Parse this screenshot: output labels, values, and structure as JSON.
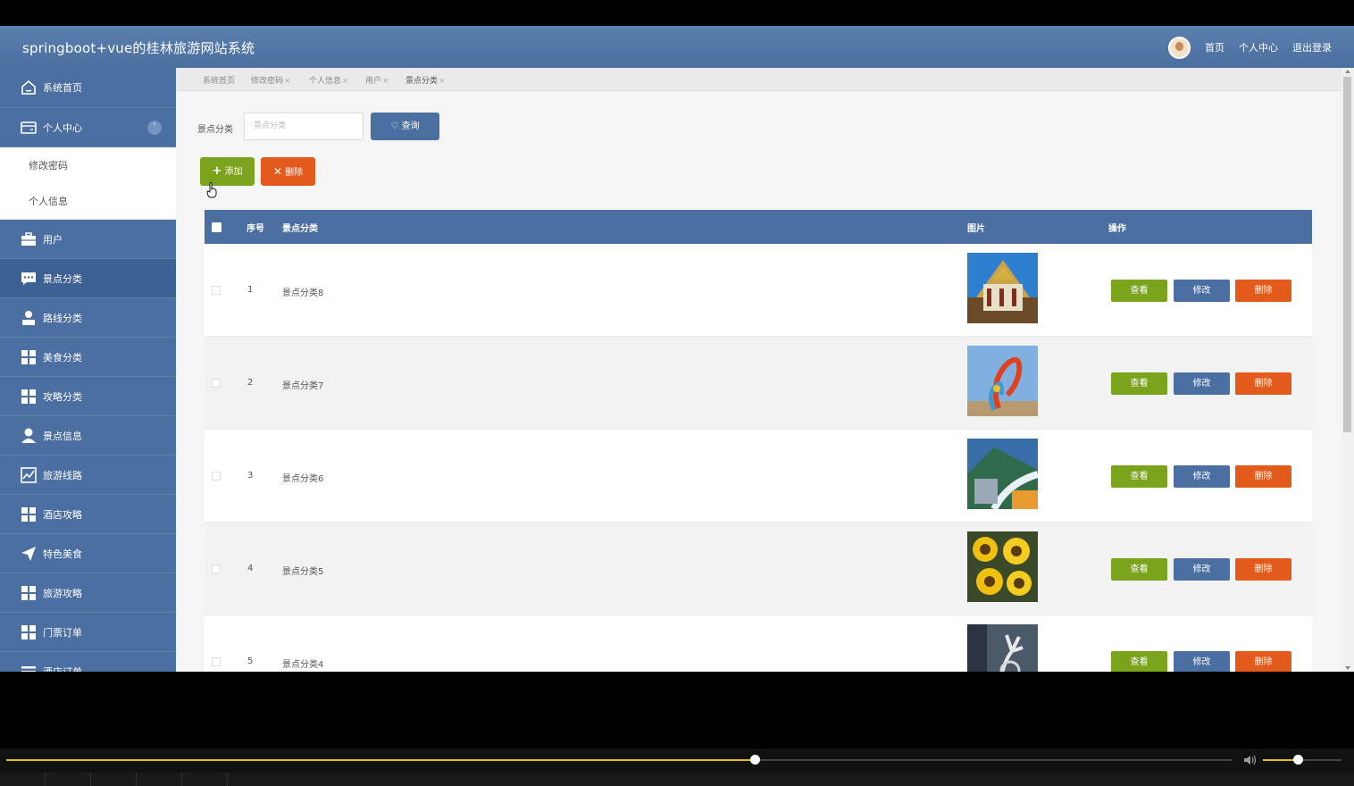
{
  "header": {
    "title": "springboot+vue的桂林旅游网站系统",
    "nav": {
      "home": "首页",
      "personal": "个人中心",
      "logout": "退出登录"
    }
  },
  "sidebar": {
    "items": [
      {
        "label": "系统首页",
        "icon": "home-icon"
      },
      {
        "label": "个人中心",
        "icon": "card-icon",
        "expanded": true,
        "children": [
          "修改密码",
          "个人信息"
        ]
      },
      {
        "label": "用户",
        "icon": "briefcase-icon"
      },
      {
        "label": "景点分类",
        "icon": "chat-icon",
        "active": true
      },
      {
        "label": "路线分类",
        "icon": "user-badge-icon"
      },
      {
        "label": "美食分类",
        "icon": "grid-icon"
      },
      {
        "label": "攻略分类",
        "icon": "grid-icon"
      },
      {
        "label": "景点信息",
        "icon": "user-icon"
      },
      {
        "label": "旅游线路",
        "icon": "chart-icon"
      },
      {
        "label": "酒店攻略",
        "icon": "grid-icon"
      },
      {
        "label": "特色美食",
        "icon": "send-icon"
      },
      {
        "label": "旅游攻略",
        "icon": "grid-icon"
      },
      {
        "label": "门票订单",
        "icon": "grid-icon"
      },
      {
        "label": "酒店订单",
        "icon": "list-icon"
      }
    ]
  },
  "tabs": [
    {
      "label": "系统首页",
      "closable": false
    },
    {
      "label": "修改密码",
      "closable": true
    },
    {
      "label": "个人信息",
      "closable": true
    },
    {
      "label": "用户",
      "closable": true
    },
    {
      "label": "景点分类",
      "closable": true,
      "active": true
    }
  ],
  "tab_close": "×",
  "search": {
    "label": "景点分类",
    "placeholder": "景点分类",
    "button": "查询"
  },
  "actions": {
    "add": "添加",
    "delete": "删除"
  },
  "table": {
    "headers": {
      "index": "序号",
      "category": "景点分类",
      "image": "图片",
      "ops": "操作"
    },
    "rows": [
      {
        "index": "1",
        "category": "景点分类8",
        "image": "temple"
      },
      {
        "index": "2",
        "category": "景点分类7",
        "image": "sculpture"
      },
      {
        "index": "3",
        "category": "景点分类6",
        "image": "landscape"
      },
      {
        "index": "4",
        "category": "景点分类5",
        "image": "sunflowers"
      },
      {
        "index": "5",
        "category": "景点分类4",
        "image": "deer-sculpture"
      }
    ],
    "row_buttons": {
      "view": "查看",
      "edit": "修改",
      "delete": "删除"
    }
  },
  "player": {
    "progress": 0.61,
    "volume": 0.44
  },
  "colors": {
    "primary": "#4a6fa0",
    "success": "#7ba31c",
    "danger": "#e25a1c",
    "progress": "#e8c400"
  }
}
